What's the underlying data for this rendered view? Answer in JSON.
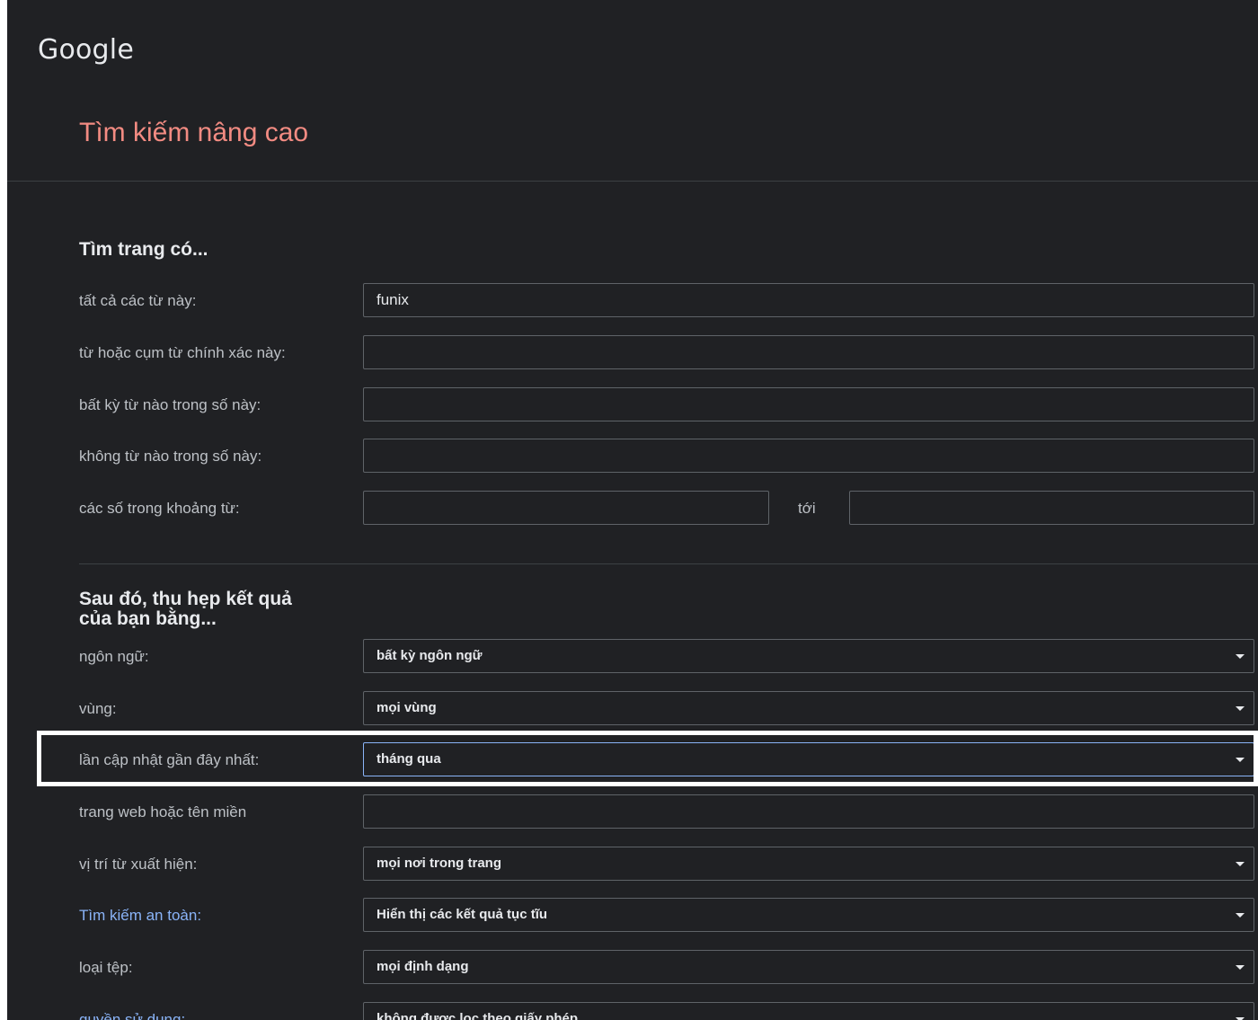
{
  "brand": "Google",
  "page_title": "Tìm kiếm nâng cao",
  "find_section": {
    "title": "Tìm trang có...",
    "all_words_label": "tất cả các từ này:",
    "all_words_value": "funix",
    "exact_phrase_label": "từ hoặc cụm từ chính xác này:",
    "exact_phrase_value": "",
    "any_words_label": "bất kỳ từ nào trong số này:",
    "any_words_value": "",
    "none_words_label": "không từ nào trong số này:",
    "none_words_value": "",
    "number_range_label": "các số trong khoảng từ:",
    "number_range_from": "",
    "number_range_to_label": "tới",
    "number_range_to": ""
  },
  "narrow_section": {
    "title_line1": "Sau đó, thu hẹp kết quả",
    "title_line2": "của bạn bằng...",
    "language_label": "ngôn ngữ:",
    "language_value": "bất kỳ ngôn ngữ",
    "region_label": "vùng:",
    "region_value": "mọi vùng",
    "last_update_label": "lần cập nhật gần đây nhất:",
    "last_update_value": "tháng qua",
    "site_label": "trang web hoặc tên miền",
    "site_value": "",
    "terms_appearing_label": "vị trí từ xuất hiện:",
    "terms_appearing_value": "mọi nơi trong trang",
    "safesearch_label": "Tìm kiếm an toàn:",
    "safesearch_value": "Hiển thị các kết quả tục tĩu",
    "file_type_label": "loại tệp:",
    "file_type_value": "mọi định dạng",
    "usage_rights_label": "quyền sử dụng:",
    "usage_rights_value": "không được lọc theo giấy phép"
  },
  "colors": {
    "background": "#202124",
    "title_accent": "#f28b82",
    "link": "#8ab4f8",
    "highlight_frame": "#ffffff"
  },
  "icons": {
    "dropdown": "caret-down-icon"
  }
}
